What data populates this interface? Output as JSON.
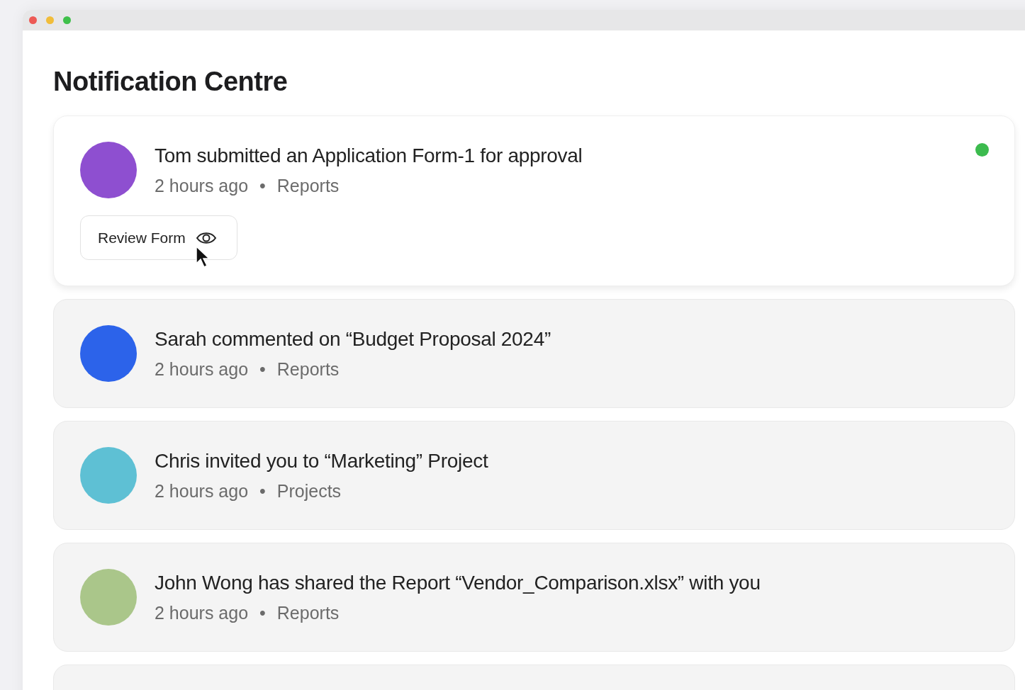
{
  "heading": "Notification Centre",
  "notifications": [
    {
      "color": "#8e4fd0",
      "title": "Tom submitted an Application Form-1 for approval",
      "time": "2 hours ago",
      "separator": "•",
      "category": "Reports",
      "unread": true,
      "expanded": true,
      "action": "Review Form"
    },
    {
      "color": "#2c63ea",
      "title": "Sarah commented on “Budget Proposal 2024”",
      "time": "2 hours ago",
      "separator": "•",
      "category": "Reports",
      "unread": false,
      "expanded": false
    },
    {
      "color": "#5ec0d4",
      "title": "Chris invited you to “Marketing” Project",
      "time": "2 hours ago",
      "separator": "•",
      "category": "Projects",
      "unread": false,
      "expanded": false
    },
    {
      "color": "#aac68a",
      "title": "John Wong has shared the Report “Vendor_Comparison.xlsx” with you",
      "time": "2 hours ago",
      "separator": "•",
      "category": "Reports",
      "unread": false,
      "expanded": false
    }
  ]
}
